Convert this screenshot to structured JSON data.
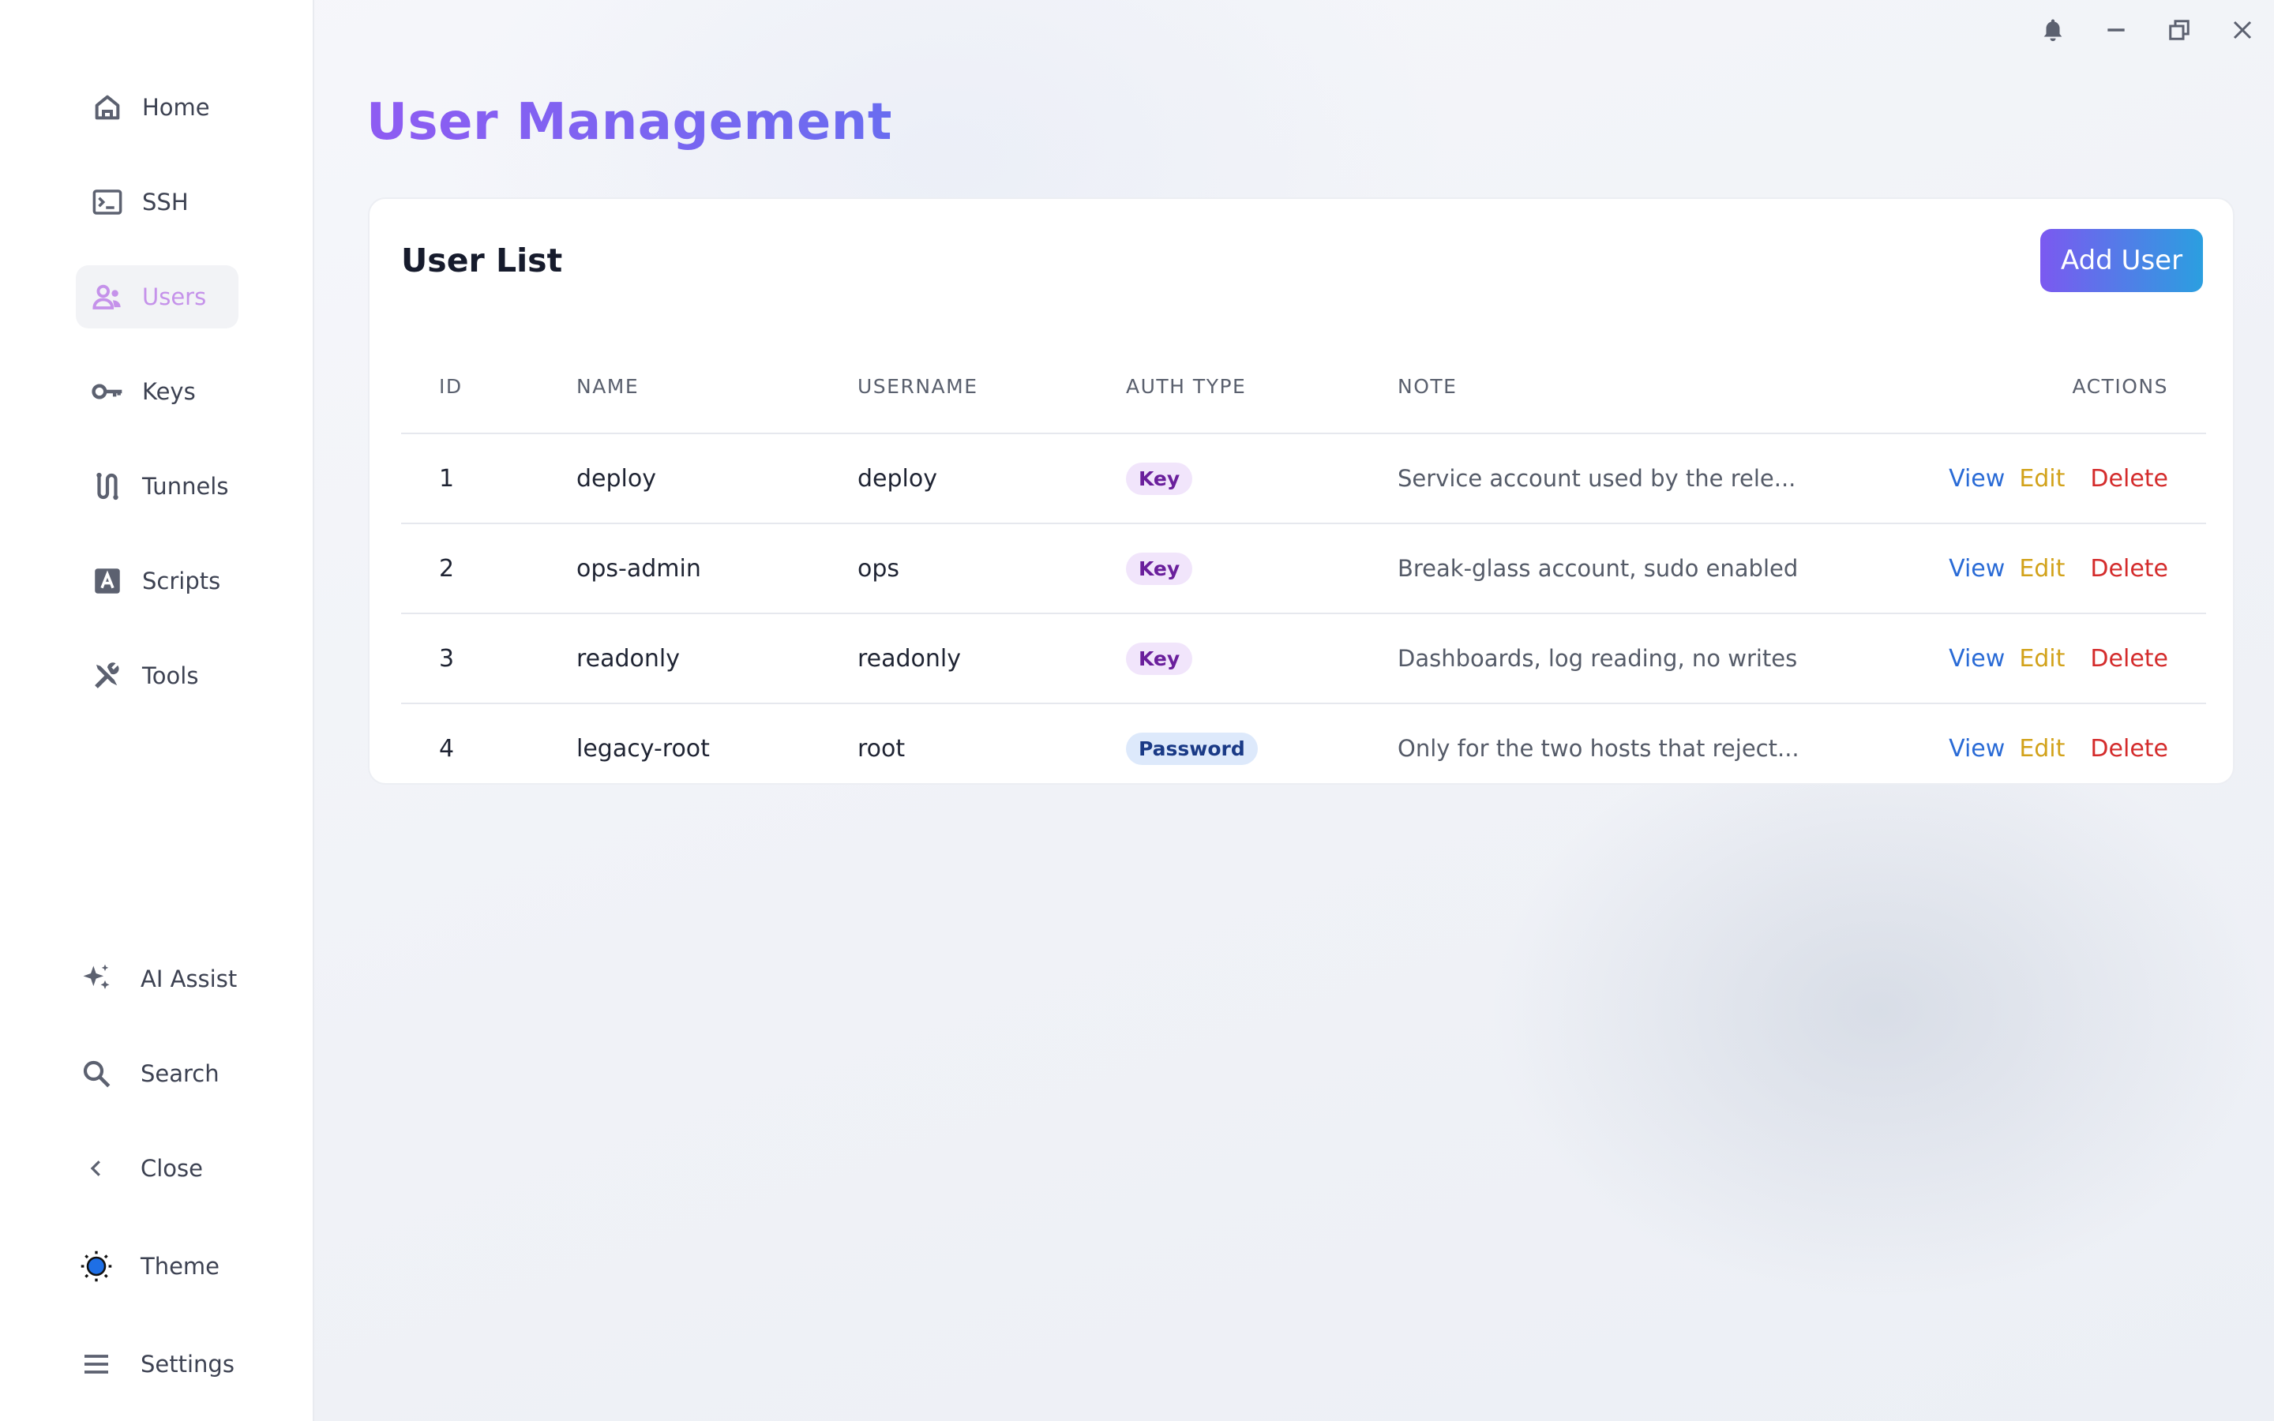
{
  "app": {
    "title": "User Management"
  },
  "colors": {
    "accent": "#8e5cf2",
    "active_nav": "#c592ea",
    "view": "#2a6bd6",
    "edit": "#d2a21a",
    "delete": "#d42c2c"
  },
  "sidebar": {
    "items": [
      {
        "label": "Home",
        "icon": "home-icon",
        "active": false
      },
      {
        "label": "SSH",
        "icon": "terminal-icon",
        "active": false
      },
      {
        "label": "Users",
        "icon": "users-icon",
        "active": true
      },
      {
        "label": "Keys",
        "icon": "key-icon",
        "active": false
      },
      {
        "label": "Tunnels",
        "icon": "tunnel-icon",
        "active": false
      },
      {
        "label": "Scripts",
        "icon": "script-icon",
        "active": false
      },
      {
        "label": "Tools",
        "icon": "tools-icon",
        "active": false
      }
    ],
    "bottom": [
      {
        "label": "AI Assist",
        "icon": "sparkle-icon"
      },
      {
        "label": "Search",
        "icon": "search-icon"
      },
      {
        "label": "Close",
        "icon": "chevron-left-icon"
      },
      {
        "label": "Theme",
        "icon": "sun-icon"
      },
      {
        "label": "Settings",
        "icon": "menu-icon"
      }
    ]
  },
  "window_controls": [
    "bell-icon",
    "minimize-icon",
    "restore-icon",
    "close-icon"
  ],
  "card": {
    "title": "User List",
    "add_button": "Add User",
    "columns": [
      "ID",
      "NAME",
      "USERNAME",
      "AUTH TYPE",
      "NOTE",
      "ACTIONS"
    ],
    "rows": [
      {
        "id": "1",
        "name": "deploy",
        "username": "deploy",
        "auth": "Key",
        "note": "Service account used by the rele..."
      },
      {
        "id": "2",
        "name": "ops-admin",
        "username": "ops",
        "auth": "Key",
        "note": "Break-glass account, sudo enabled"
      },
      {
        "id": "3",
        "name": "readonly",
        "username": "readonly",
        "auth": "Key",
        "note": "Dashboards, log reading, no writes"
      },
      {
        "id": "4",
        "name": "legacy-root",
        "username": "root",
        "auth": "Password",
        "note": "Only for the two hosts that reject..."
      }
    ],
    "actions": {
      "view": "View",
      "edit": "Edit",
      "delete": "Delete"
    }
  }
}
